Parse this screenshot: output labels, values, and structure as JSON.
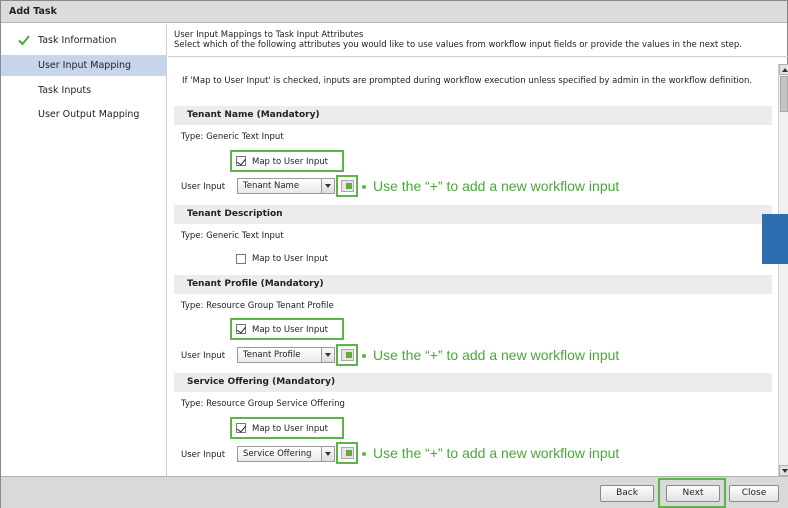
{
  "title": "Add Task",
  "sidebar": {
    "items": [
      {
        "label": "Task Information",
        "completed": true,
        "active": false
      },
      {
        "label": "User Input Mapping",
        "completed": false,
        "active": true
      },
      {
        "label": "Task Inputs",
        "completed": false,
        "active": false
      },
      {
        "label": "User Output Mapping",
        "completed": false,
        "active": false
      }
    ]
  },
  "main": {
    "header_line1": "User Input Mappings to Task Input Attributes",
    "header_line2": "Select which of the following attributes you would like to use values from workflow input fields or provide the values in the next step.",
    "note": "If 'Map to User Input' is checked, inputs are prompted during workflow execution unless specified by admin in the workflow definition.",
    "checkbox_label": "Map to User Input",
    "user_input_label": "User Input",
    "hint": "Use the “+” to add a new workflow input",
    "sections": [
      {
        "title": "Tenant Name (Mandatory)",
        "type": "Type: Generic Text Input",
        "checked": true,
        "selected_value": "Tenant Name"
      },
      {
        "title": "Tenant Description",
        "type": "Type: Generic Text Input",
        "checked": false
      },
      {
        "title": "Tenant Profile (Mandatory)",
        "type": "Type: Resource Group Tenant Profile",
        "checked": true,
        "selected_value": "Tenant Profile"
      },
      {
        "title": "Service Offering (Mandatory)",
        "type": "Type: Resource Group Service Offering",
        "checked": true,
        "selected_value": "Service Offering"
      }
    ]
  },
  "footer": {
    "back": "Back",
    "next": "Next",
    "close": "Close"
  },
  "colors": {
    "highlight_green": "#5db549",
    "hint_green": "#4aa83a",
    "active_row": "#c6d5ea",
    "accent_blue": "#2e6cb0"
  }
}
